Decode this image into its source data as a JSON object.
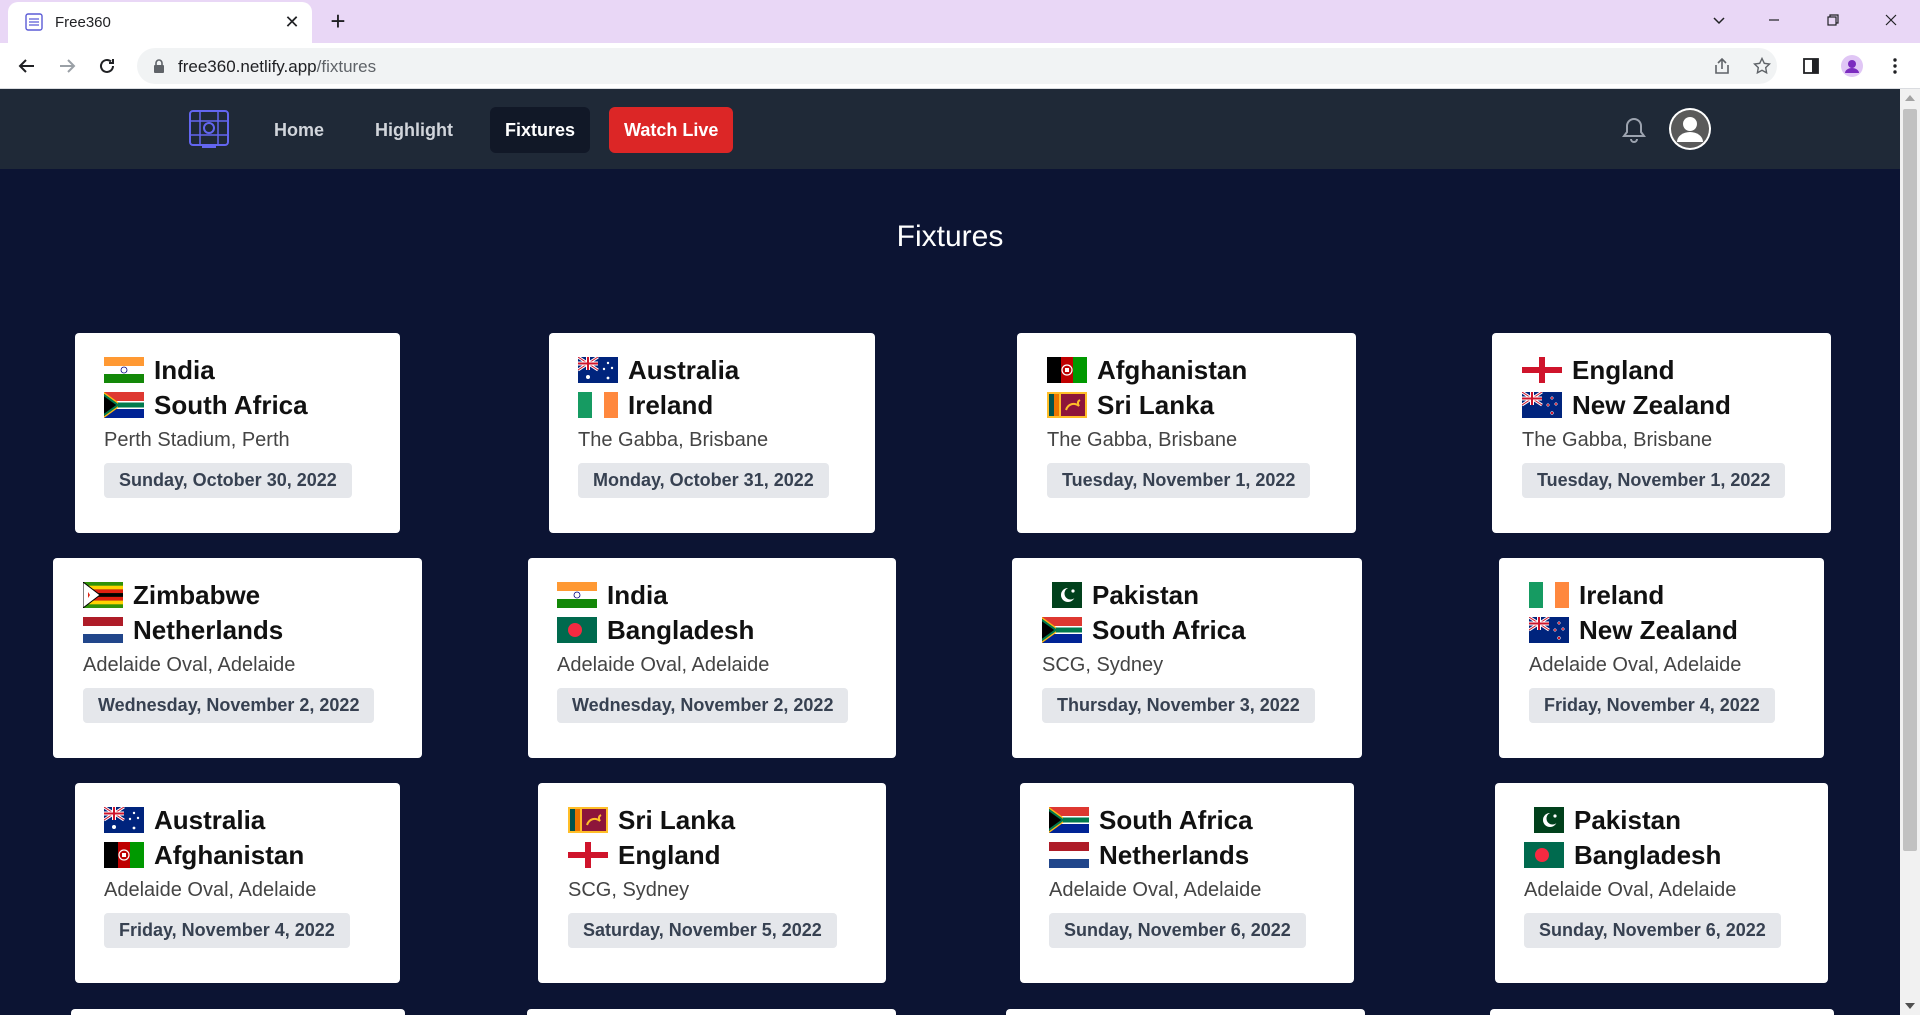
{
  "browser": {
    "tab_title": "Free360",
    "tab_close": "✕",
    "new_tab": "+",
    "url_host": "free360.netlify.app",
    "url_path": "/fixtures"
  },
  "nav": {
    "home": "Home",
    "highlight": "Highlight",
    "fixtures": "Fixtures",
    "watch_live": "Watch Live"
  },
  "page_title": "Fixtures",
  "flags": {
    "India": "india-flag-icon",
    "South Africa": "south-africa-flag-icon",
    "Australia": "australia-flag-icon",
    "Ireland": "ireland-flag-icon",
    "Afghanistan": "afghanistan-flag-icon",
    "Sri Lanka": "sri-lanka-flag-icon",
    "England": "england-flag-icon",
    "New Zealand": "new-zealand-flag-icon",
    "Zimbabwe": "zimbabwe-flag-icon",
    "Netherlands": "netherlands-flag-icon",
    "Bangladesh": "bangladesh-flag-icon",
    "Pakistan": "pakistan-flag-icon"
  },
  "fixtures": [
    {
      "team1": "India",
      "team2": "South Africa",
      "venue": "Perth Stadium, Perth",
      "date": "Sunday, October 30, 2022"
    },
    {
      "team1": "Australia",
      "team2": "Ireland",
      "venue": "The Gabba, Brisbane",
      "date": "Monday, October 31, 2022"
    },
    {
      "team1": "Afghanistan",
      "team2": "Sri Lanka",
      "venue": "The Gabba, Brisbane",
      "date": "Tuesday, November 1, 2022"
    },
    {
      "team1": "England",
      "team2": "New Zealand",
      "venue": "The Gabba, Brisbane",
      "date": "Tuesday, November 1, 2022"
    },
    {
      "team1": "Zimbabwe",
      "team2": "Netherlands",
      "venue": "Adelaide Oval, Adelaide",
      "date": "Wednesday, November 2, 2022"
    },
    {
      "team1": "India",
      "team2": "Bangladesh",
      "venue": "Adelaide Oval, Adelaide",
      "date": "Wednesday, November 2, 2022"
    },
    {
      "team1": "Pakistan",
      "team2": "South Africa",
      "venue": "SCG, Sydney",
      "date": "Thursday, November 3, 2022"
    },
    {
      "team1": "Ireland",
      "team2": "New Zealand",
      "venue": "Adelaide Oval, Adelaide",
      "date": "Friday, November 4, 2022"
    },
    {
      "team1": "Australia",
      "team2": "Afghanistan",
      "venue": "Adelaide Oval, Adelaide",
      "date": "Friday, November 4, 2022"
    },
    {
      "team1": "Sri Lanka",
      "team2": "England",
      "venue": "SCG, Sydney",
      "date": "Saturday, November 5, 2022"
    },
    {
      "team1": "South Africa",
      "team2": "Netherlands",
      "venue": "Adelaide Oval, Adelaide",
      "date": "Sunday, November 6, 2022"
    },
    {
      "team1": "Pakistan",
      "team2": "Bangladesh",
      "venue": "Adelaide Oval, Adelaide",
      "date": "Sunday, November 6, 2022"
    }
  ],
  "colors": {
    "page_bg": "#0c1433",
    "navbar_bg": "#1f2937",
    "live_button": "#dc2626",
    "tab_strip": "#e9d7f6"
  }
}
